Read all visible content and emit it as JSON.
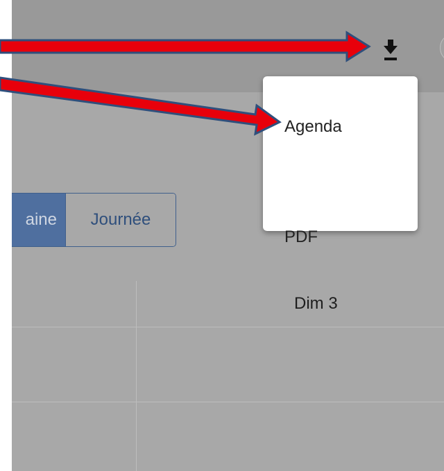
{
  "toolbar": {
    "download_icon": "download-icon",
    "download_menu": {
      "items": [
        {
          "label": "Agenda"
        },
        {
          "label": "PDF"
        }
      ]
    }
  },
  "calendar": {
    "view_toggle": {
      "week_label_partial": "aine",
      "day_label": "Journée"
    },
    "columns": [
      {
        "label": "Dim 3"
      }
    ]
  },
  "annotations": {
    "arrow_fill": "#e8000b",
    "arrow_outline": "#2f4f7c"
  }
}
